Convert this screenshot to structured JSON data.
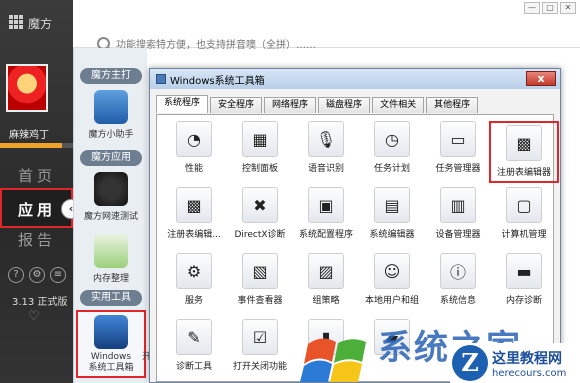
{
  "app": {
    "name": "魔方",
    "search_placeholder": "功能搜索特方便，也支持拼音噢（全拼）……"
  },
  "user": {
    "name": "麻辣鸡丁",
    "level_progress": 0.85
  },
  "nav": [
    {
      "label": "首页"
    },
    {
      "label": "应用"
    },
    {
      "label": "报告"
    }
  ],
  "version": "3.13 正式版",
  "sections": {
    "main": "魔方主打",
    "apps": "魔方应用",
    "tools": "实用工具"
  },
  "tools": [
    {
      "label": "魔方小助手"
    },
    {
      "label": "魔方网速测试"
    },
    {
      "label": "内存整理"
    },
    {
      "label": "Windows\n系统工具箱"
    }
  ],
  "truncated_next": "开",
  "dialog": {
    "title": "Windows系统工具箱",
    "close": "x",
    "tabs": [
      "系统程序",
      "安全程序",
      "网络程序",
      "磁盘程序",
      "文件相关",
      "其他程序"
    ],
    "items": [
      {
        "label": "性能",
        "icon": "performance-icon"
      },
      {
        "label": "控制面板",
        "icon": "control-panel-icon"
      },
      {
        "label": "语音识别",
        "icon": "speech-icon"
      },
      {
        "label": "任务计划",
        "icon": "clock-icon"
      },
      {
        "label": "任务管理器",
        "icon": "monitor-icon"
      },
      {
        "label": "注册表编辑器",
        "icon": "registry-icon"
      },
      {
        "label": "注册表编辑...",
        "icon": "registry-icon"
      },
      {
        "label": "DirectX诊断",
        "icon": "directx-icon"
      },
      {
        "label": "系统配置程序",
        "icon": "config-icon"
      },
      {
        "label": "系统编辑器",
        "icon": "editor-icon"
      },
      {
        "label": "设备管理器",
        "icon": "device-icon"
      },
      {
        "label": "计算机管理",
        "icon": "computer-icon"
      },
      {
        "label": "服务",
        "icon": "gear-icon"
      },
      {
        "label": "事件查看器",
        "icon": "event-icon"
      },
      {
        "label": "组策略",
        "icon": "policy-icon"
      },
      {
        "label": "本地用户和组",
        "icon": "users-icon"
      },
      {
        "label": "系统信息",
        "icon": "info-icon"
      },
      {
        "label": "内存诊断",
        "icon": "memory-icon"
      },
      {
        "label": "诊断工具",
        "icon": "diagnose-icon"
      },
      {
        "label": "打开关闭功能",
        "icon": "features-icon"
      },
      {
        "label": "",
        "icon": "cmd-icon"
      },
      {
        "label": "",
        "icon": "folder-icon"
      }
    ]
  },
  "watermark": {
    "text": "系统之家",
    "site_name": "这里教程网",
    "site_url": "herecours.com"
  },
  "colors": {
    "accent": "#e0252b",
    "sidebar": "#2f2f2f",
    "watermark_blue": "#1d5fb0"
  }
}
